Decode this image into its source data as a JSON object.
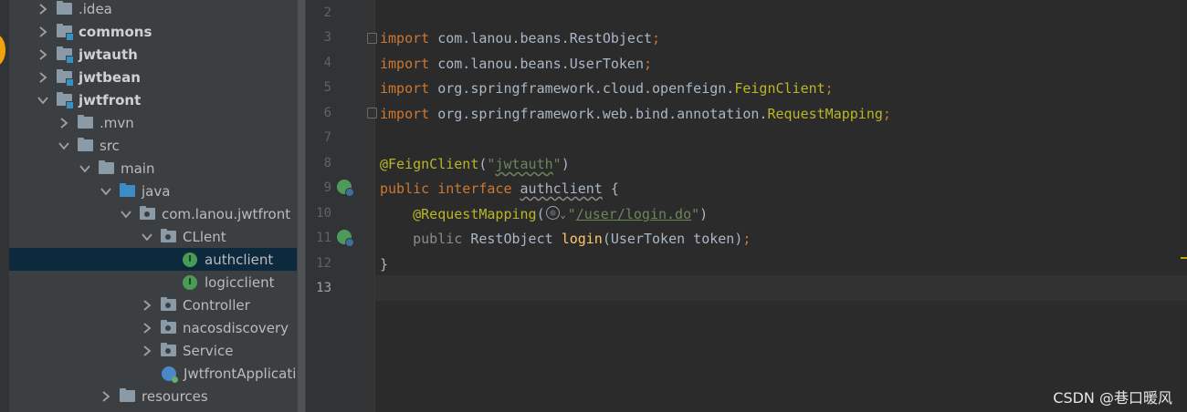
{
  "tree": {
    "items": [
      {
        "label": ".idea"
      },
      {
        "label": "commons"
      },
      {
        "label": "jwtauth"
      },
      {
        "label": "jwtbean"
      },
      {
        "label": "jwtfront"
      },
      {
        "label": ".mvn"
      },
      {
        "label": "src"
      },
      {
        "label": "main"
      },
      {
        "label": "java"
      },
      {
        "label": "com.lanou.jwtfront"
      },
      {
        "label": "CLlent"
      },
      {
        "label": "authclient"
      },
      {
        "label": "logicclient"
      },
      {
        "label": "Controller"
      },
      {
        "label": "nacosdiscovery"
      },
      {
        "label": "Service"
      },
      {
        "label": "JwtfrontApplicatio"
      },
      {
        "label": "resources"
      }
    ],
    "interface_glyph": "I"
  },
  "editor": {
    "line_numbers": [
      "2",
      "3",
      "4",
      "5",
      "6",
      "7",
      "8",
      "9",
      "10",
      "11",
      "12",
      "13"
    ],
    "lines": {
      "l3": {
        "kw": "import",
        "pkg": " com.lanou.beans.RestObject",
        "semi": ";"
      },
      "l4": {
        "kw": "import",
        "pkg": " com.lanou.beans.UserToken",
        "semi": ";"
      },
      "l5": {
        "kw": "import",
        "pkg": " org.springframework.cloud.openfeign.",
        "cls": "FeignClient",
        "semi": ";"
      },
      "l6": {
        "kw": "import",
        "pkg": " org.springframework.web.bind.annotation.",
        "cls": "RequestMapping",
        "semi": ";"
      },
      "l8": {
        "ann": "@FeignClient",
        "open": "(",
        "str_q1": "\"",
        "str_body": "jwtauth",
        "str_q2": "\"",
        "close": ")"
      },
      "l9": {
        "kw1": "public",
        "kw2": "interface",
        "name": "authclient",
        "brace": " {"
      },
      "l10": {
        "ann": "@RequestMapping",
        "open": "(",
        "chev": "⌄",
        "q1": "\"",
        "path": "/user/login.do",
        "q2": "\"",
        "close": ")"
      },
      "l11": {
        "kw": "public",
        "type": " RestObject ",
        "method": "login",
        "params": "(UserToken token)",
        "semi": ";"
      },
      "l12": {
        "brace": "}"
      }
    }
  },
  "watermark": "CSDN @巷口暖风",
  "colors": {
    "keyword": "#cc7832",
    "annotation": "#bbb529",
    "string": "#6a8759",
    "method": "#ffc66d",
    "text": "#a9b7c6",
    "selection": "#0d293e"
  }
}
